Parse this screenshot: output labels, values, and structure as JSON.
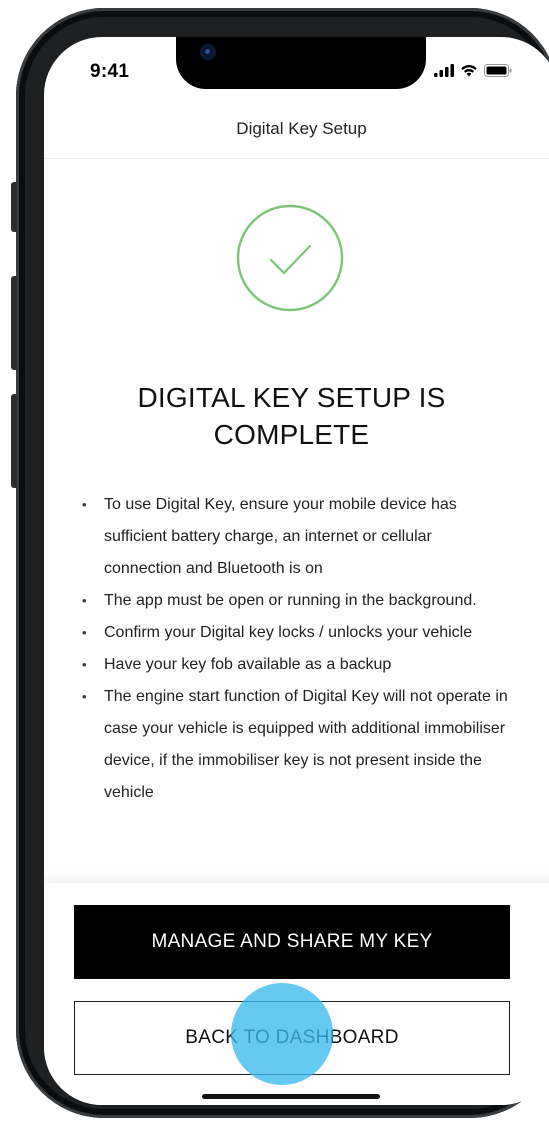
{
  "status_bar": {
    "time": "9:41"
  },
  "nav": {
    "title": "Digital Key Setup"
  },
  "success": {
    "icon": "checkmark-circle-icon",
    "accent_color": "#7cc576"
  },
  "headline": {
    "line1": "DIGITAL KEY SETUP IS",
    "line2": "COMPLETE"
  },
  "instructions": [
    "To use Digital Key, ensure your mobile device has sufficient battery charge, an internet or cellular connection and Bluetooth is on",
    "The app must be open or running in the background.",
    "Confirm your Digital key locks / unlocks your vehicle",
    "Have your key fob available as a backup",
    "The engine start function of Digital Key will not operate in case your vehicle is equipped with additional immobiliser device, if the immobiliser key is not present inside the vehicle"
  ],
  "actions": {
    "primary_label": "MANAGE AND SHARE MY KEY",
    "secondary_label": "BACK TO DASHBOARD"
  },
  "colors": {
    "primary_button": "#000000",
    "touch_indicator": "#3abaee"
  }
}
